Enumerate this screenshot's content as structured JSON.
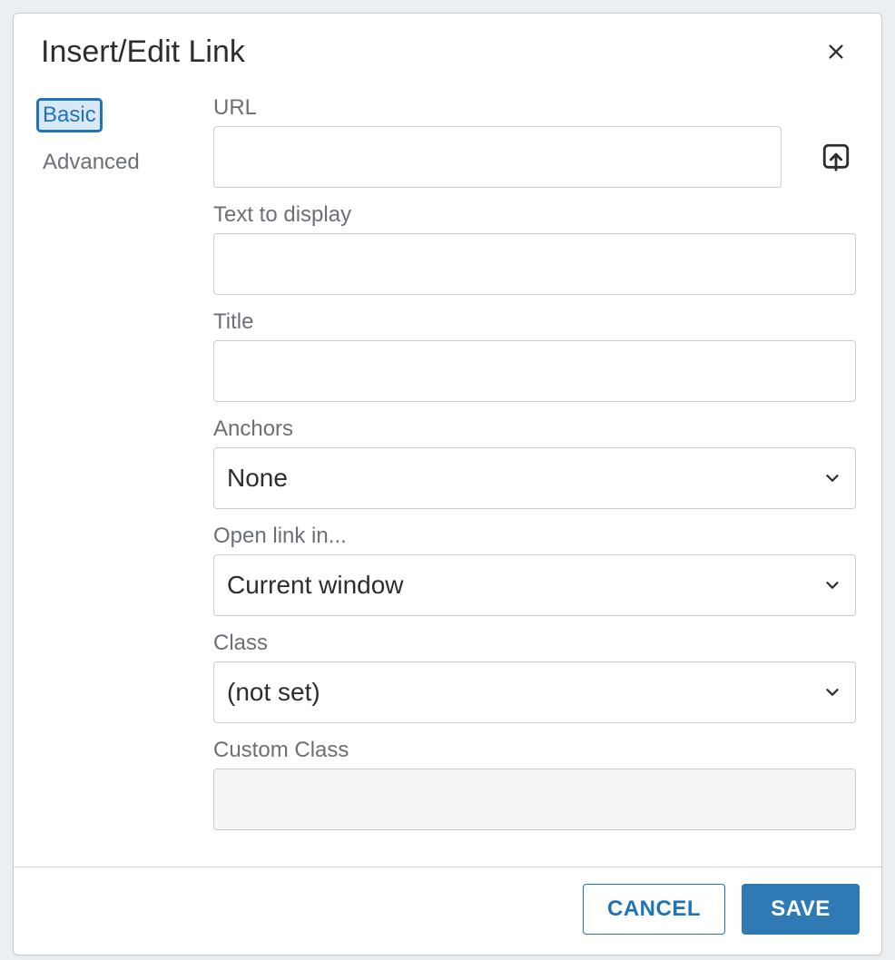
{
  "dialog": {
    "title": "Insert/Edit Link"
  },
  "tabs": {
    "basic": "Basic",
    "advanced": "Advanced"
  },
  "fields": {
    "url": {
      "label": "URL",
      "value": ""
    },
    "text": {
      "label": "Text to display",
      "value": ""
    },
    "title": {
      "label": "Title",
      "value": ""
    },
    "anchors": {
      "label": "Anchors",
      "value": "None"
    },
    "open_in": {
      "label": "Open link in...",
      "value": "Current window"
    },
    "class": {
      "label": "Class",
      "value": "(not set)"
    },
    "custom_class": {
      "label": "Custom Class",
      "value": ""
    }
  },
  "footer": {
    "cancel": "CANCEL",
    "save": "SAVE"
  }
}
